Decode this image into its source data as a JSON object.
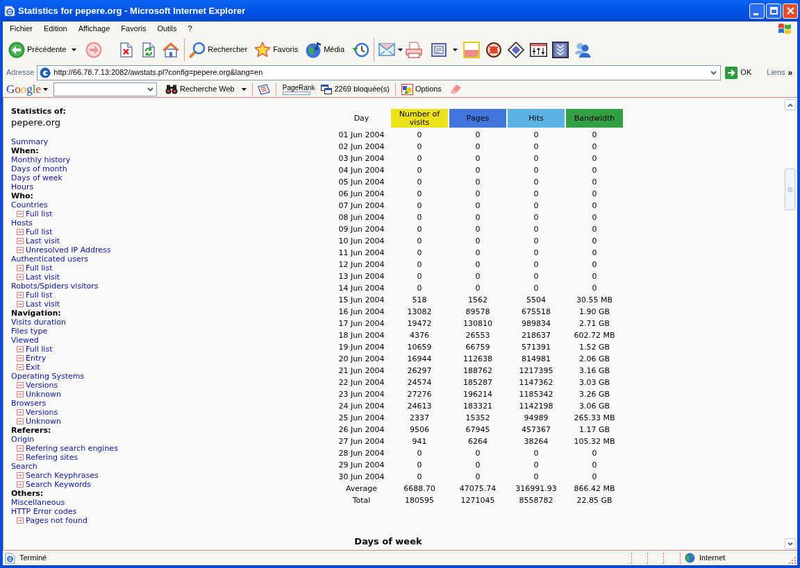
{
  "window": {
    "title": "Statistics for pepere.org - Microsoft Internet Explorer"
  },
  "menu_bar": [
    "Fichier",
    "Edition",
    "Affichage",
    "Favoris",
    "Outils",
    "?"
  ],
  "toolbar": [
    {
      "kind": "button",
      "label": "Précédente",
      "dropdown": true,
      "disabled": false
    },
    {
      "kind": "button",
      "dropdown": false,
      "disabled": true
    },
    {
      "kind": "button",
      "dropdown": false,
      "disabled": false
    },
    {
      "kind": "button",
      "dropdown": false,
      "disabled": false
    },
    {
      "kind": "button",
      "dropdown": false,
      "disabled": false
    },
    {
      "kind": "separator"
    },
    {
      "kind": "button",
      "label": "Rechercher",
      "dropdown": false,
      "disabled": false
    },
    {
      "kind": "button",
      "label": "Favoris",
      "dropdown": false,
      "disabled": false
    },
    {
      "kind": "button",
      "label": "Média",
      "dropdown": false,
      "disabled": false
    },
    {
      "kind": "button",
      "dropdown": false,
      "disabled": false
    },
    {
      "kind": "separator"
    },
    {
      "kind": "button",
      "dropdown": true,
      "disabled": false
    },
    {
      "kind": "button",
      "dropdown": false,
      "disabled": false
    },
    {
      "kind": "button",
      "dropdown": true,
      "disabled": false
    },
    {
      "kind": "button",
      "dropdown": false,
      "disabled": false
    },
    {
      "kind": "button",
      "dropdown": false,
      "disabled": false
    },
    {
      "kind": "button",
      "dropdown": false,
      "disabled": false
    },
    {
      "kind": "button",
      "dropdown": false,
      "disabled": false
    },
    {
      "kind": "button",
      "dropdown": false,
      "disabled": false
    },
    {
      "kind": "button",
      "dropdown": false,
      "disabled": false
    }
  ],
  "address_bar": {
    "label": "Adresse",
    "url": "http://66.78.7.13:2082/awstats.pl?config=pepere.org&lang=en",
    "go_button": "OK",
    "links": "Liens",
    "more": "»"
  },
  "google_toolbar": {
    "logo": "Google",
    "search_button": "Recherche Web",
    "pagerank": {
      "label": "PageRank",
      "level": 0
    },
    "blocked_popups": "2269 bloquée(s)",
    "options_button": "Options"
  },
  "sidebar": {
    "title": "Statistics of:",
    "site": "pepere.org",
    "items": [
      {
        "kind": "link",
        "text": "Summary"
      },
      {
        "kind": "heading",
        "text": "When:"
      },
      {
        "kind": "link",
        "text": "Monthly history"
      },
      {
        "kind": "link",
        "text": "Days of month"
      },
      {
        "kind": "link",
        "text": "Days of week"
      },
      {
        "kind": "link",
        "text": "Hours"
      },
      {
        "kind": "heading",
        "text": "Who:"
      },
      {
        "kind": "link",
        "text": "Countries",
        "children": [
          {
            "text": "Full list"
          }
        ]
      },
      {
        "kind": "link",
        "text": "Hosts",
        "children": [
          {
            "text": "Full list"
          },
          {
            "text": "Last visit"
          },
          {
            "text": "Unresolved IP Address"
          }
        ]
      },
      {
        "kind": "link",
        "text": "Authenticated users",
        "children": [
          {
            "text": "Full list"
          },
          {
            "text": "Last visit"
          }
        ]
      },
      {
        "kind": "link",
        "text": "Robots/Spiders visitors",
        "children": [
          {
            "text": "Full list"
          },
          {
            "text": "Last visit"
          }
        ]
      },
      {
        "kind": "heading",
        "text": "Navigation:"
      },
      {
        "kind": "link",
        "text": "Visits duration"
      },
      {
        "kind": "link",
        "text": "Files type"
      },
      {
        "kind": "link",
        "text": "Viewed",
        "children": [
          {
            "text": "Full list"
          },
          {
            "text": "Entry"
          },
          {
            "text": "Exit"
          }
        ]
      },
      {
        "kind": "link",
        "text": "Operating Systems",
        "children": [
          {
            "text": "Versions"
          },
          {
            "text": "Unknown"
          }
        ]
      },
      {
        "kind": "link",
        "text": "Browsers",
        "children": [
          {
            "text": "Versions"
          },
          {
            "text": "Unknown"
          }
        ]
      },
      {
        "kind": "heading",
        "text": "Referers:"
      },
      {
        "kind": "link",
        "text": "Origin",
        "children": [
          {
            "text": "Refering search engines"
          },
          {
            "text": "Refering sites"
          }
        ]
      },
      {
        "kind": "link",
        "text": "Search",
        "children": [
          {
            "text": "Search Keyphrases"
          },
          {
            "text": "Search Keywords"
          }
        ]
      },
      {
        "kind": "heading",
        "text": "Others:"
      },
      {
        "kind": "link",
        "text": "Miscellaneous"
      },
      {
        "kind": "link",
        "text": "HTTP Error codes",
        "children": [
          {
            "text": "Pages not found"
          }
        ]
      }
    ]
  },
  "table": {
    "columns": [
      {
        "label": "Day"
      },
      {
        "label": "Number of visits",
        "color": "#ece11a"
      },
      {
        "label": "Pages",
        "color": "#4477dd"
      },
      {
        "label": "Hits",
        "color": "#5eb1e5"
      },
      {
        "label": "Bandwidth",
        "color": "#35a043"
      }
    ],
    "rows": [
      [
        "01 Jun 2004",
        "0",
        "0",
        "0",
        "0"
      ],
      [
        "02 Jun 2004",
        "0",
        "0",
        "0",
        "0"
      ],
      [
        "03 Jun 2004",
        "0",
        "0",
        "0",
        "0"
      ],
      [
        "04 Jun 2004",
        "0",
        "0",
        "0",
        "0"
      ],
      [
        "05 Jun 2004",
        "0",
        "0",
        "0",
        "0"
      ],
      [
        "06 Jun 2004",
        "0",
        "0",
        "0",
        "0"
      ],
      [
        "07 Jun 2004",
        "0",
        "0",
        "0",
        "0"
      ],
      [
        "08 Jun 2004",
        "0",
        "0",
        "0",
        "0"
      ],
      [
        "09 Jun 2004",
        "0",
        "0",
        "0",
        "0"
      ],
      [
        "10 Jun 2004",
        "0",
        "0",
        "0",
        "0"
      ],
      [
        "11 Jun 2004",
        "0",
        "0",
        "0",
        "0"
      ],
      [
        "12 Jun 2004",
        "0",
        "0",
        "0",
        "0"
      ],
      [
        "13 Jun 2004",
        "0",
        "0",
        "0",
        "0"
      ],
      [
        "14 Jun 2004",
        "0",
        "0",
        "0",
        "0"
      ],
      [
        "15 Jun 2004",
        "518",
        "1562",
        "5504",
        "30.55 MB"
      ],
      [
        "16 Jun 2004",
        "13082",
        "89578",
        "675518",
        "1.90 GB"
      ],
      [
        "17 Jun 2004",
        "19472",
        "130810",
        "989834",
        "2.71 GB"
      ],
      [
        "18 Jun 2004",
        "4376",
        "26553",
        "218637",
        "602.72 MB"
      ],
      [
        "19 Jun 2004",
        "10659",
        "66759",
        "571391",
        "1.52 GB"
      ],
      [
        "20 Jun 2004",
        "16944",
        "112638",
        "814981",
        "2.06 GB"
      ],
      [
        "21 Jun 2004",
        "26297",
        "188762",
        "1217395",
        "3.16 GB"
      ],
      [
        "22 Jun 2004",
        "24574",
        "185287",
        "1147362",
        "3.03 GB"
      ],
      [
        "23 Jun 2004",
        "27276",
        "196214",
        "1185342",
        "3.26 GB"
      ],
      [
        "24 Jun 2004",
        "24613",
        "183321",
        "1142198",
        "3.06 GB"
      ],
      [
        "25 Jun 2004",
        "2337",
        "15352",
        "94989",
        "265.33 MB"
      ],
      [
        "26 Jun 2004",
        "9506",
        "67945",
        "457367",
        "1.17 GB"
      ],
      [
        "27 Jun 2004",
        "941",
        "6264",
        "38264",
        "105.32 MB"
      ],
      [
        "28 Jun 2004",
        "0",
        "0",
        "0",
        "0"
      ],
      [
        "29 Jun 2004",
        "0",
        "0",
        "0",
        "0"
      ],
      [
        "30 Jun 2004",
        "0",
        "0",
        "0",
        "0"
      ],
      [
        "Average",
        "6688.70",
        "47075.74",
        "316991.93",
        "866.42 MB"
      ],
      [
        "Total",
        "180595",
        "1271045",
        "8558782",
        "22.85 GB"
      ]
    ]
  },
  "next_section": {
    "title": "Days of week"
  },
  "status_bar": {
    "text": "Terminé",
    "zone": "Internet"
  }
}
